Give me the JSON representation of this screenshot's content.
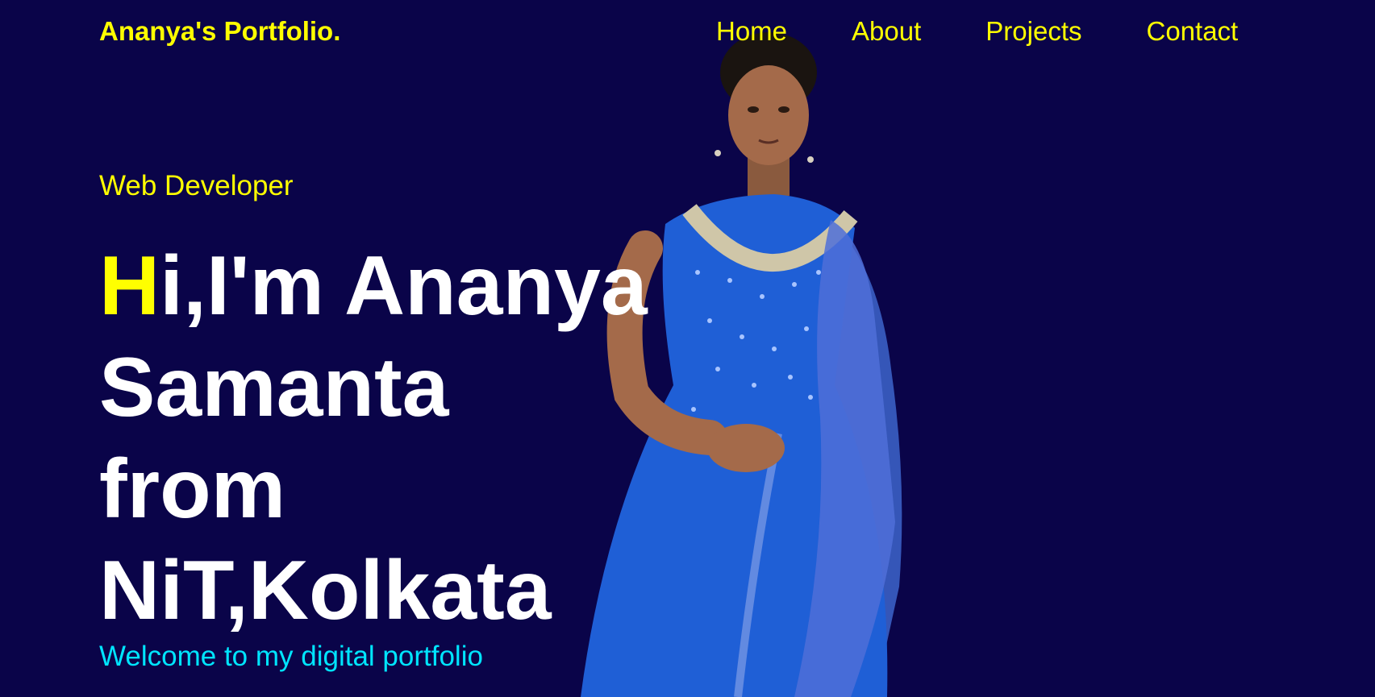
{
  "header": {
    "brand": "Ananya's Portfolio.",
    "nav": [
      {
        "label": "Home"
      },
      {
        "label": "About"
      },
      {
        "label": "Projects"
      },
      {
        "label": "Contact"
      }
    ]
  },
  "hero": {
    "role": "Web Developer",
    "headline": {
      "accent_letter": "H",
      "line1_rest": "i,I'm Ananya",
      "line2": "Samanta",
      "line3": "from",
      "line4": "NiT,Kolkata"
    },
    "welcome": "Welcome to my digital portfolio",
    "photo": "portrait-photo"
  },
  "colors": {
    "background": "#0a0449",
    "accent": "#ffff00",
    "headline": "#ffffff",
    "welcome": "#00e5ff"
  }
}
